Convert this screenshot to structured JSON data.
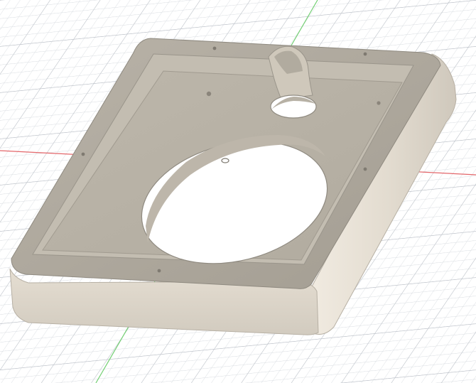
{
  "viewport": {
    "background": "#ffffff",
    "grid_minor_color": "#d7dbe0",
    "grid_major_color": "#b9bec6",
    "x_axis_color": "#e3666a",
    "y_axis_color": "#73cf73"
  },
  "model": {
    "part": "rectangular-tray-with-circular-holes",
    "material_color": "#d9d1c3",
    "material_shadow_color": "#a9a397",
    "material_highlight_color": "#eee8dd",
    "edge_color": "#8f8a80",
    "holes": [
      "large-oval-hole",
      "small-round-hole"
    ],
    "mounting_points": 7
  }
}
